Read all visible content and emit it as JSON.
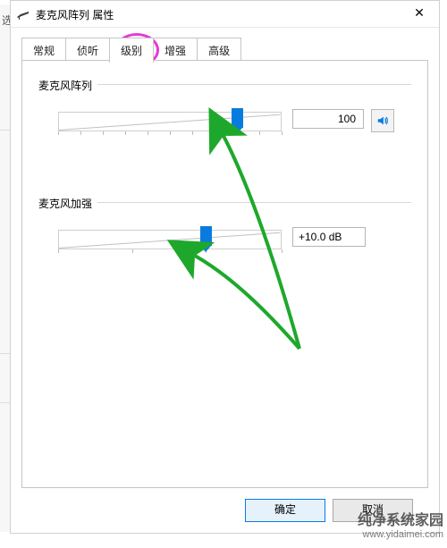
{
  "window": {
    "title": "麦克风阵列 属性",
    "close_glyph": "✕"
  },
  "tabs": [
    {
      "label": "常规"
    },
    {
      "label": "侦听"
    },
    {
      "label": "级别"
    },
    {
      "label": "增强"
    },
    {
      "label": "高级"
    }
  ],
  "active_tab_index": 2,
  "groups": {
    "mic": {
      "label": "麦克风阵列",
      "value_text": "100",
      "slider_percent": 80
    },
    "boost": {
      "label": "麦克风加强",
      "value_text": "+10.0 dB",
      "slider_percent": 66
    }
  },
  "buttons": {
    "ok": "确定",
    "cancel": "取消"
  },
  "bg_partial_text": "选",
  "watermark": {
    "line1": "纯净系统家园",
    "line2": "www.yidaimei.com"
  },
  "icons": {
    "speaker": "speaker-icon",
    "mic": "mic-icon"
  }
}
